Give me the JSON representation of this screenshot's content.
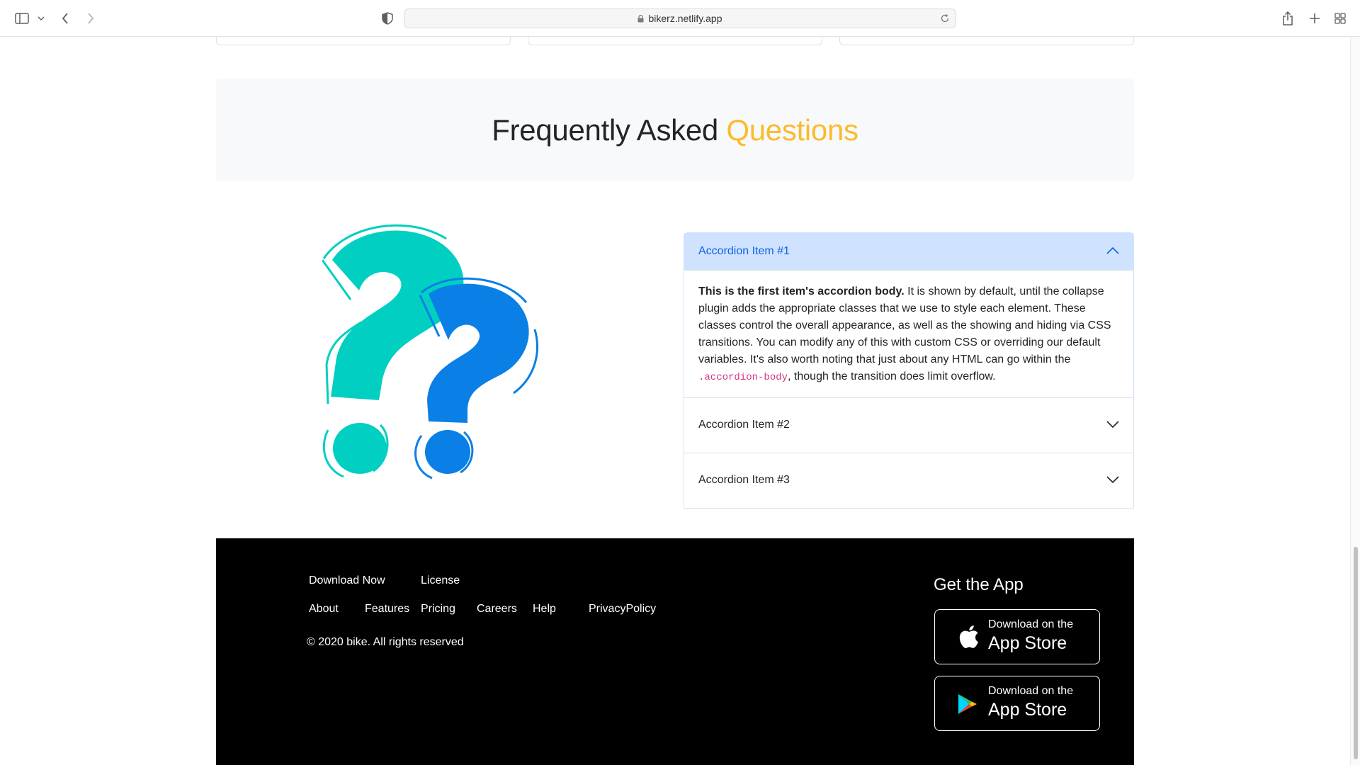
{
  "browser": {
    "url": "bikerz.netlify.app"
  },
  "faq": {
    "title_main": "Frequently Asked ",
    "title_accent": "Questions"
  },
  "accordion": [
    {
      "label": "Accordion Item #1",
      "expanded": true,
      "body_bold": "This is the first item's accordion body.",
      "body_text": " It is shown by default, until the collapse plugin adds the appropriate classes that we use to style each element. These classes control the overall appearance, as well as the showing and hiding via CSS transitions. You can modify any of this with custom CSS or overriding our default variables. It's also worth noting that just about any HTML can go within the ",
      "body_code": ".accordion-body",
      "body_tail": ", though the transition does limit overflow."
    },
    {
      "label": "Accordion Item #2",
      "expanded": false
    },
    {
      "label": "Accordion Item #3",
      "expanded": false
    }
  ],
  "footer": {
    "links_row1": [
      "Download Now",
      "License"
    ],
    "links_row2": [
      "About",
      "Features",
      "Pricing",
      "Careers",
      "Help",
      "PrivacyPolicy"
    ],
    "copyright": "© 2020 bike. All rights reserved",
    "get_app": "Get the App",
    "store_buttons": [
      {
        "small": "Download on the",
        "big": "App Store",
        "icon": "apple-icon"
      },
      {
        "small": "Download on the",
        "big": "App Store",
        "icon": "google-play-icon"
      }
    ]
  },
  "colors": {
    "accent": "#fbbb2d",
    "accordion_active_bg": "#cfe2ff",
    "accordion_active_text": "#0c63e4",
    "footer_bg": "#000000",
    "teal": "#00cfc1",
    "blue": "#0a7fe5"
  }
}
